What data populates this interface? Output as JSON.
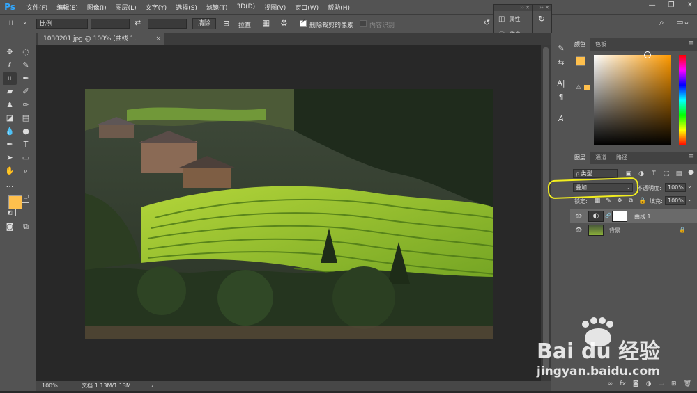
{
  "app": {
    "logo": "Ps"
  },
  "menu": [
    "文件(F)",
    "编辑(E)",
    "图像(I)",
    "图层(L)",
    "文字(Y)",
    "选择(S)",
    "滤镜(T)",
    "3D(D)",
    "视图(V)",
    "窗口(W)",
    "帮助(H)"
  ],
  "options": {
    "ratio": "比例",
    "clear": "清除",
    "straighten": "拉直",
    "delete_cropped": "删除裁剪的像素",
    "content_aware": "内容识别"
  },
  "document": {
    "tab_title": "1030201.jpg @ 100% (曲线 1, RGB/8#) *",
    "close": "×"
  },
  "status": {
    "zoom": "100%",
    "doc_size": "文档:1.13M/1.13M"
  },
  "properties_panel": {
    "properties": "属性",
    "info": "信息"
  },
  "color_panel": {
    "tabs": [
      "颜色",
      "色板"
    ],
    "foreground": "#ffc04d",
    "accent": "#ff9a00"
  },
  "layers_panel": {
    "tabs": [
      "图层",
      "通道",
      "路径"
    ],
    "filter_kind": "ρ 类型",
    "blend_mode": "叠加",
    "opacity_label": "不透明度:",
    "opacity_value": "100%",
    "lock_label": "锁定:",
    "fill_label": "填充:",
    "fill_value": "100%",
    "layers": [
      {
        "name": "曲线 1",
        "selected": true
      },
      {
        "name": "背景",
        "selected": false
      }
    ]
  },
  "watermark": {
    "brand": "Bai du 经验",
    "url": "jingyan.baidu.com"
  },
  "annotation_color": "#f2ee1f"
}
